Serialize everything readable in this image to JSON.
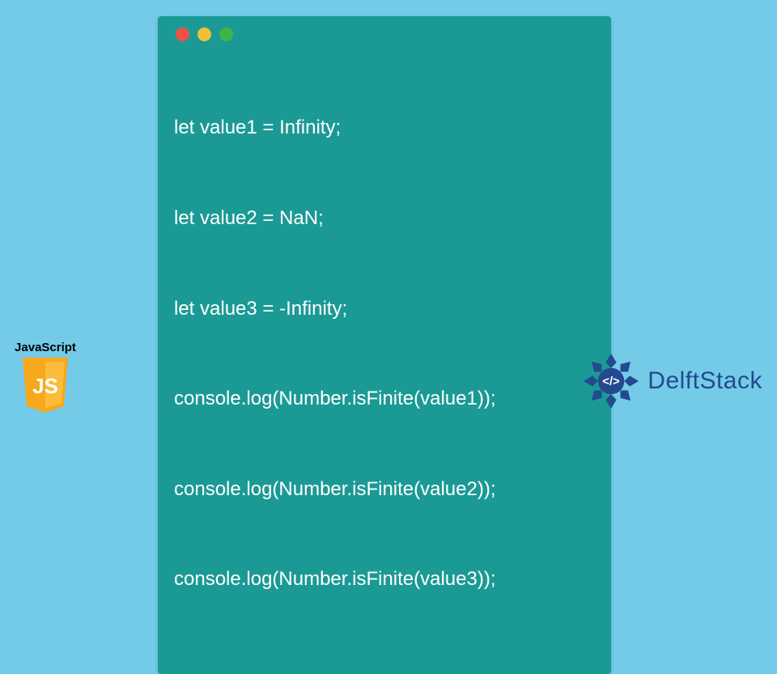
{
  "code": {
    "lines": [
      "let value1 = Infinity;",
      "let value2 = NaN;",
      "let value3 = -Infinity;",
      "console.log(Number.isFinite(value1));",
      "console.log(Number.isFinite(value2));",
      "console.log(Number.isFinite(value3));"
    ]
  },
  "window_dots": {
    "red": "#ec5047",
    "yellow": "#f2be3a",
    "green": "#3fb549"
  },
  "js_badge": {
    "label": "JavaScript",
    "glyph": "JS"
  },
  "brand": {
    "name": "DelftStack"
  },
  "colors": {
    "bg": "#74cbe8",
    "window": "#1b9a95",
    "brand_blue": "#234a8e",
    "js_yellow": "#f7a81b"
  }
}
